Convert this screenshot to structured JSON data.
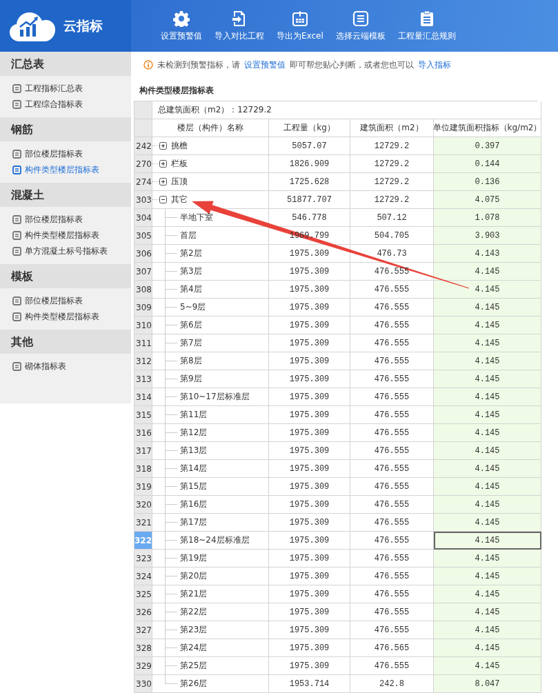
{
  "app": {
    "title": "云指标"
  },
  "toolbar": [
    {
      "label": "设置预警值"
    },
    {
      "label": "导入对比工程"
    },
    {
      "label": "导出为Excel"
    },
    {
      "label": "选择云端模板"
    },
    {
      "label": "工程量汇总规则"
    }
  ],
  "sidebar": {
    "sections": [
      {
        "title": "汇总表",
        "items": [
          {
            "label": "工程指标汇总表",
            "selected": false
          },
          {
            "label": "工程综合指标表",
            "selected": false
          }
        ]
      },
      {
        "title": "钢筋",
        "items": [
          {
            "label": "部位楼层指标表",
            "selected": false
          },
          {
            "label": "构件类型楼层指标表",
            "selected": true
          }
        ]
      },
      {
        "title": "混凝土",
        "items": [
          {
            "label": "部位楼层指标表",
            "selected": false
          },
          {
            "label": "构件类型楼层指标表",
            "selected": false
          },
          {
            "label": "单方混凝土标号指标表",
            "selected": false
          }
        ]
      },
      {
        "title": "模板",
        "items": [
          {
            "label": "部位楼层指标表",
            "selected": false
          },
          {
            "label": "构件类型楼层指标表",
            "selected": false
          }
        ]
      },
      {
        "title": "其他",
        "items": [
          {
            "label": "砌体指标表",
            "selected": false
          }
        ]
      }
    ]
  },
  "notice": {
    "parts": [
      {
        "kind": "text",
        "text": "未检测到预警指标，请"
      },
      {
        "kind": "link",
        "text": "设置预警值"
      },
      {
        "kind": "text",
        "text": "即可帮您贴心判断，或者您也可以"
      },
      {
        "kind": "link",
        "text": "导入指标"
      }
    ]
  },
  "table": {
    "title": "构件类型楼层指标表",
    "summary": "总建筑面积（m2）：12729.2",
    "columns": [
      "楼层（构件）名称",
      "工程量（kg）",
      "建筑面积（m2）",
      "单位建筑面积指标（kg/m2）"
    ],
    "rows": [
      {
        "row_number": "242",
        "name": "挑檐",
        "quantity": "5057.07",
        "area": "12729.2",
        "index": "0.397",
        "expanded": false,
        "selected": false
      },
      {
        "row_number": "270",
        "name": "栏板",
        "quantity": "1826.909",
        "area": "12729.2",
        "index": "0.144",
        "expanded": false,
        "selected": false
      },
      {
        "row_number": "274",
        "name": "压顶",
        "quantity": "1725.628",
        "area": "12729.2",
        "index": "0.136",
        "expanded": false,
        "selected": false
      },
      {
        "row_number": "303",
        "name": "其它",
        "quantity": "51877.707",
        "area": "12729.2",
        "index": "4.075",
        "expanded": true,
        "selected": false,
        "children": [
          {
            "row_number": "304",
            "name": "半地下室",
            "quantity": "546.778",
            "area": "507.12",
            "index": "1.078",
            "selected": false
          },
          {
            "row_number": "305",
            "name": "首层",
            "quantity": "1969.799",
            "area": "504.705",
            "index": "3.903",
            "selected": false
          },
          {
            "row_number": "306",
            "name": "第2层",
            "quantity": "1975.309",
            "area": "476.73",
            "index": "4.143",
            "selected": false
          },
          {
            "row_number": "307",
            "name": "第3层",
            "quantity": "1975.309",
            "area": "476.555",
            "index": "4.145",
            "selected": false
          },
          {
            "row_number": "308",
            "name": "第4层",
            "quantity": "1975.309",
            "area": "476.555",
            "index": "4.145",
            "selected": false
          },
          {
            "row_number": "309",
            "name": "5~9层",
            "quantity": "1975.309",
            "area": "476.555",
            "index": "4.145",
            "selected": false
          },
          {
            "row_number": "310",
            "name": "第6层",
            "quantity": "1975.309",
            "area": "476.555",
            "index": "4.145",
            "selected": false
          },
          {
            "row_number": "311",
            "name": "第7层",
            "quantity": "1975.309",
            "area": "476.555",
            "index": "4.145",
            "selected": false
          },
          {
            "row_number": "312",
            "name": "第8层",
            "quantity": "1975.309",
            "area": "476.555",
            "index": "4.145",
            "selected": false
          },
          {
            "row_number": "313",
            "name": "第9层",
            "quantity": "1975.309",
            "area": "476.555",
            "index": "4.145",
            "selected": false
          },
          {
            "row_number": "314",
            "name": "第10~17层标准层",
            "quantity": "1975.309",
            "area": "476.555",
            "index": "4.145",
            "selected": false
          },
          {
            "row_number": "315",
            "name": "第11层",
            "quantity": "1975.309",
            "area": "476.555",
            "index": "4.145",
            "selected": false
          },
          {
            "row_number": "316",
            "name": "第12层",
            "quantity": "1975.309",
            "area": "476.555",
            "index": "4.145",
            "selected": false
          },
          {
            "row_number": "317",
            "name": "第13层",
            "quantity": "1975.309",
            "area": "476.555",
            "index": "4.145",
            "selected": false
          },
          {
            "row_number": "318",
            "name": "第14层",
            "quantity": "1975.309",
            "area": "476.555",
            "index": "4.145",
            "selected": false
          },
          {
            "row_number": "319",
            "name": "第15层",
            "quantity": "1975.309",
            "area": "476.555",
            "index": "4.145",
            "selected": false
          },
          {
            "row_number": "320",
            "name": "第16层",
            "quantity": "1975.309",
            "area": "476.555",
            "index": "4.145",
            "selected": false
          },
          {
            "row_number": "321",
            "name": "第17层",
            "quantity": "1975.309",
            "area": "476.555",
            "index": "4.145",
            "selected": false
          },
          {
            "row_number": "322",
            "name": "第18~24层标准层",
            "quantity": "1975.309",
            "area": "476.555",
            "index": "4.145",
            "selected": true
          },
          {
            "row_number": "323",
            "name": "第19层",
            "quantity": "1975.309",
            "area": "476.555",
            "index": "4.145",
            "selected": false
          },
          {
            "row_number": "324",
            "name": "第20层",
            "quantity": "1975.309",
            "area": "476.555",
            "index": "4.145",
            "selected": false
          },
          {
            "row_number": "325",
            "name": "第21层",
            "quantity": "1975.309",
            "area": "476.555",
            "index": "4.145",
            "selected": false
          },
          {
            "row_number": "326",
            "name": "第22层",
            "quantity": "1975.309",
            "area": "476.555",
            "index": "4.145",
            "selected": false
          },
          {
            "row_number": "327",
            "name": "第23层",
            "quantity": "1975.309",
            "area": "476.555",
            "index": "4.145",
            "selected": false
          },
          {
            "row_number": "328",
            "name": "第24层",
            "quantity": "1975.309",
            "area": "476.565",
            "index": "4.145",
            "selected": false
          },
          {
            "row_number": "329",
            "name": "第25层",
            "quantity": "1975.309",
            "area": "476.555",
            "index": "4.145",
            "selected": false
          },
          {
            "row_number": "330",
            "name": "第26层",
            "quantity": "1953.714",
            "area": "242.8",
            "index": "8.047",
            "selected": false
          }
        ]
      }
    ]
  }
}
